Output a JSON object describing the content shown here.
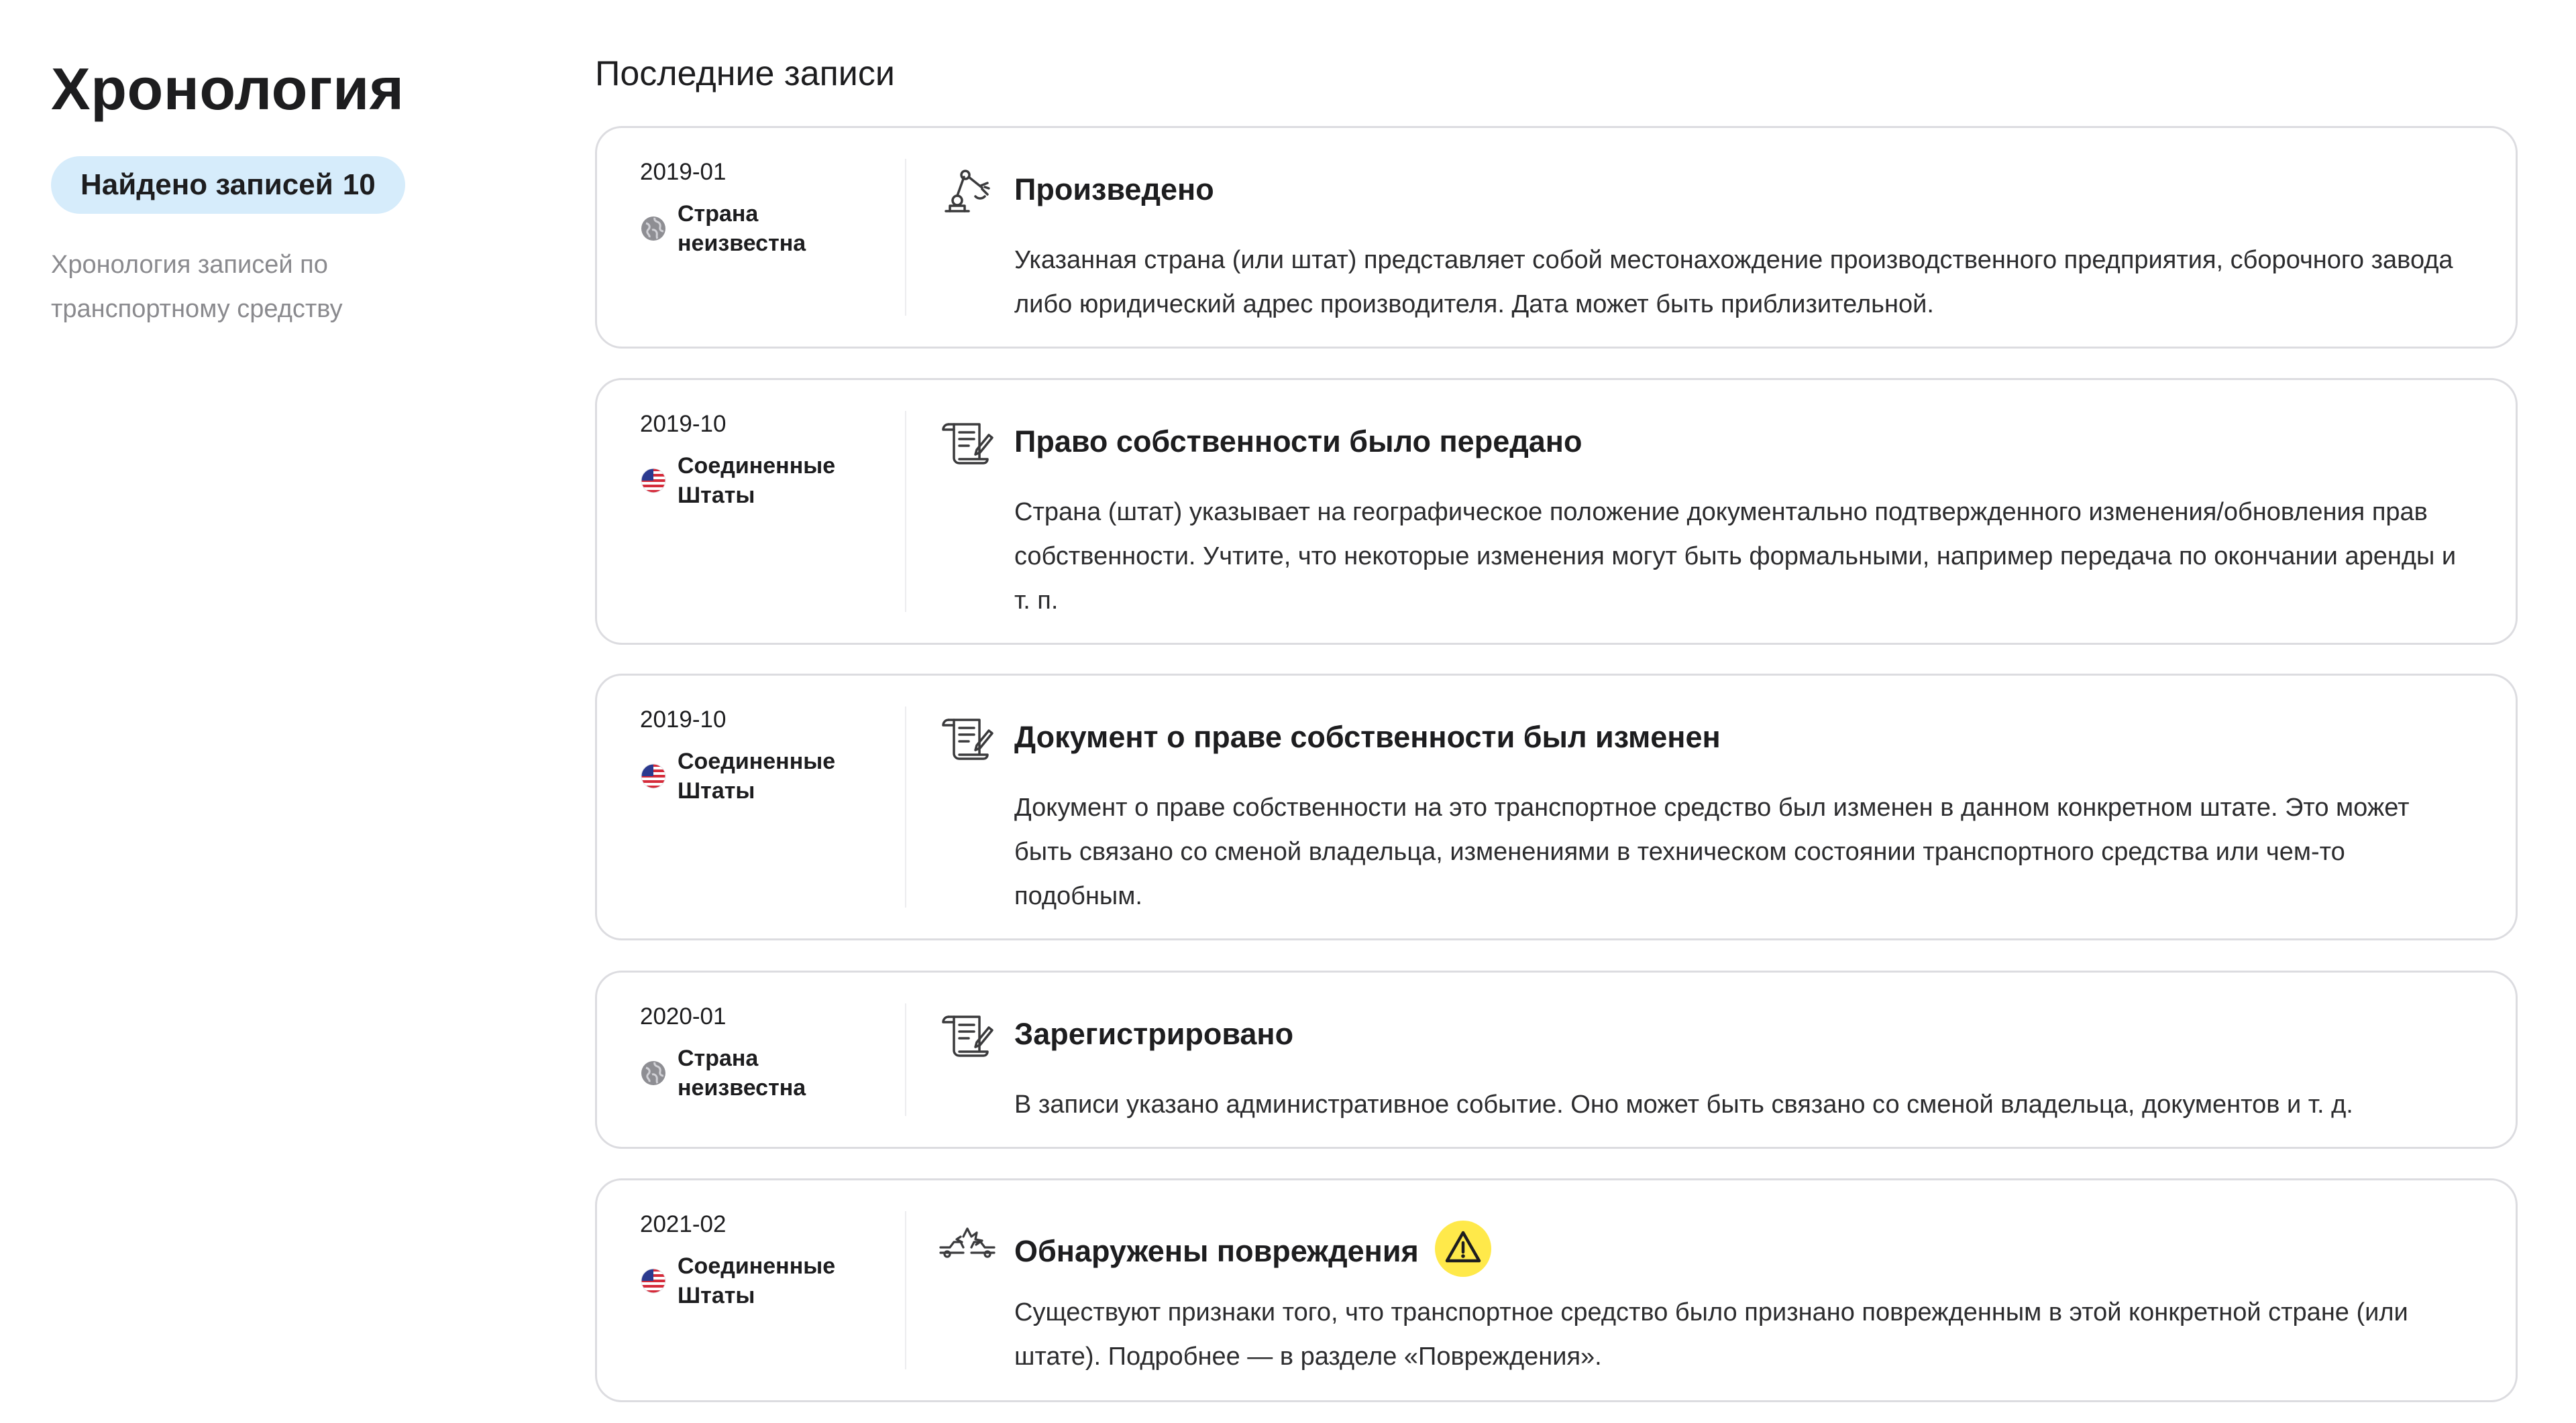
{
  "sidebar": {
    "title": "Хронология",
    "badge_label": "Найдено записей",
    "badge_count": "10",
    "description": "Хронология записей по транспортному средству"
  },
  "main": {
    "section_title": "Последние записи",
    "records": [
      {
        "date": "2019-01",
        "country": "Страна неизвестна",
        "country_icon": "globe-icon",
        "event_icon": "robot-arm-icon",
        "title": "Произведено",
        "description": "Указанная страна (или штат) представляет собой местонахождение производственного предприятия, сборочного завода либо юридический адрес производителя. Дата может быть приблизительной."
      },
      {
        "date": "2019-10",
        "country": "Соединенные Штаты",
        "country_icon": "us-flag-icon",
        "event_icon": "document-scroll-icon",
        "title": "Право собственности было передано",
        "description": "Страна (штат) указывает на географическое положение документально подтвержденного изменения/обновления прав собственности. Учтите, что некоторые изменения могут быть формальными, например передача по окончании аренды и т. п."
      },
      {
        "date": "2019-10",
        "country": "Соединенные Штаты",
        "country_icon": "us-flag-icon",
        "event_icon": "document-scroll-icon",
        "title": "Документ о праве собственности был изменен",
        "description": "Документ о праве собственности на это транспортное средство был изменен в данном конкретном штате. Это может быть связано со сменой владельца, изменениями в техническом состоянии транспортного средства или чем-то подобным."
      },
      {
        "date": "2020-01",
        "country": "Страна неизвестна",
        "country_icon": "globe-icon",
        "event_icon": "document-scroll-icon",
        "title": "Зарегистрировано",
        "description": "В записи указано административное событие. Оно может быть связано со сменой владельца, документов и т. д."
      },
      {
        "date": "2021-02",
        "country": "Соединенные Штаты",
        "country_icon": "us-flag-icon",
        "event_icon": "car-crash-icon",
        "title": "Обнаружены повреждения",
        "warning_icon": "warning-icon",
        "description": "Существуют признаки того, что транспортное средство было признано поврежденным в этой конкретной стране (или штате). Подробнее — в разделе «Повреждения»."
      }
    ]
  },
  "colors": {
    "badge_bg": "#d6ecfb",
    "card_border": "#dcdce0",
    "muted_text": "#8a8a8e",
    "warning_yellow": "#ffe94a"
  }
}
